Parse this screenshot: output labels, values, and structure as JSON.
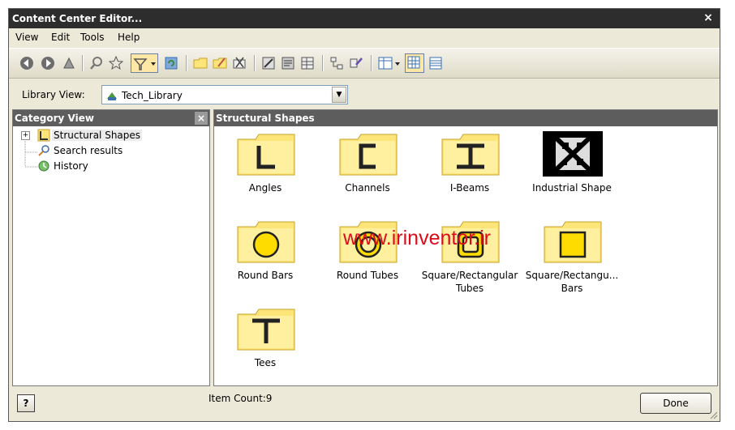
{
  "window": {
    "title": "Content Center Editor...",
    "close_glyph": "×"
  },
  "menu": {
    "items": [
      {
        "label": "View"
      },
      {
        "label": "Edit"
      },
      {
        "label": "Tools"
      },
      {
        "label": "Help"
      }
    ]
  },
  "toolbar": {
    "icons": [
      "back-icon",
      "forward-icon",
      "up-icon",
      "search-icon",
      "favorites-icon",
      "filter-icon",
      "refresh-icon",
      "new-folder-icon",
      "edit-folder-icon",
      "delete-icon",
      "table-edit-icon",
      "family-properties-icon",
      "family-table-icon",
      "family-tree-icon",
      "publish-icon",
      "view-options-icon",
      "thumbnail-view-icon",
      "detail-view-icon"
    ]
  },
  "library": {
    "label": "Library View:",
    "value": "Tech_Library"
  },
  "category_pane": {
    "title": "Category View",
    "close_glyph": "×",
    "tree": [
      {
        "label": "Structural Shapes",
        "expander": "+",
        "selected": true
      },
      {
        "label": "Search results"
      },
      {
        "label": "History"
      }
    ]
  },
  "content_pane": {
    "title": "Structural Shapes",
    "items": [
      {
        "label": "Angles",
        "icon": "angle-folder-icon"
      },
      {
        "label": "Channels",
        "icon": "channel-folder-icon"
      },
      {
        "label": "I-Beams",
        "icon": "ibeam-folder-icon"
      },
      {
        "label": "Industrial Shape",
        "icon": "industrial-shape-icon"
      },
      {
        "label": "Round Bars",
        "icon": "round-bar-folder-icon"
      },
      {
        "label": "Round Tubes",
        "icon": "round-tube-folder-icon"
      },
      {
        "label": "Square/Rectangular Tubes",
        "icon": "square-tube-folder-icon"
      },
      {
        "label": "Square/Rectangu... Bars",
        "icon": "square-bar-folder-icon"
      },
      {
        "label": "Tees",
        "icon": "tee-folder-icon"
      }
    ]
  },
  "status": {
    "help_glyph": "?",
    "item_count": "Item Count:9",
    "done_label": "Done"
  },
  "watermark": "www.irinventor.ir",
  "colors": {
    "folder_fill": "#fde57a",
    "folder_stroke": "#c9a227",
    "title_bar": "#2d2d2d",
    "pane_header": "#5d5d5d",
    "watermark": "#dd0a1a"
  }
}
